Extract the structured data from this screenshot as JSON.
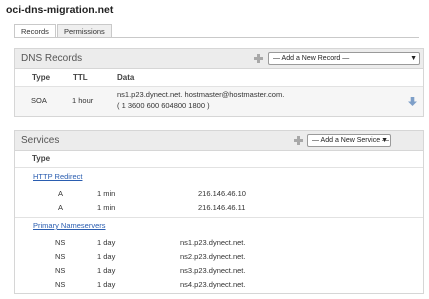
{
  "page": {
    "title": "oci-dns-migration.net"
  },
  "tabs": [
    {
      "label": "Records",
      "active": true
    },
    {
      "label": "Permissions",
      "active": false
    }
  ],
  "dns_records": {
    "title": "DNS Records",
    "add_select": "— Add a New Record —",
    "columns": {
      "type": "Type",
      "ttl": "TTL",
      "data": "Data"
    },
    "soa": {
      "type": "SOA",
      "ttl": "1 hour",
      "data_line1": "ns1.p23.dynect.net. hostmaster@hostmaster.com.",
      "data_line2": "( 1 3600 600 604800 1800 )"
    }
  },
  "services": {
    "title": "Services",
    "add_select": "— Add a New Service —",
    "columns": {
      "type": "Type"
    },
    "groups": [
      {
        "name": "HTTP Redirect",
        "rows": [
          {
            "type": "A",
            "ttl": "1 min",
            "data": "216.146.46.10"
          },
          {
            "type": "A",
            "ttl": "1 min",
            "data": "216.146.46.11"
          }
        ]
      },
      {
        "name": "Primary Nameservers",
        "rows": [
          {
            "type": "NS",
            "ttl": "1 day",
            "data": "ns1.p23.dynect.net."
          },
          {
            "type": "NS",
            "ttl": "1 day",
            "data": "ns2.p23.dynect.net."
          },
          {
            "type": "NS",
            "ttl": "1 day",
            "data": "ns3.p23.dynect.net."
          },
          {
            "type": "NS",
            "ttl": "1 day",
            "data": "ns4.p23.dynect.net."
          }
        ]
      }
    ]
  },
  "colors": {
    "link": "#2a5db0",
    "header_bg": "#ececec",
    "icon_gray": "#a8a8a8",
    "down_arrow": "#7e9fc8"
  }
}
